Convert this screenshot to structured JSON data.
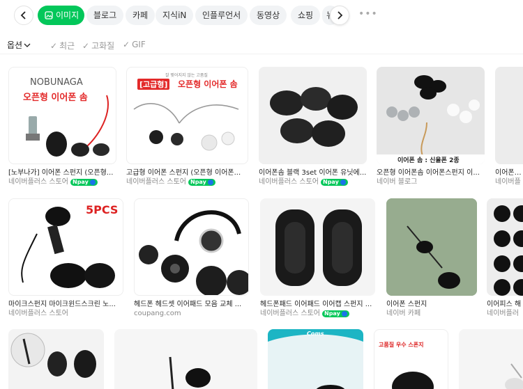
{
  "tabs": {
    "active": "이미지",
    "items": [
      "블로그",
      "카페",
      "지식iN",
      "인플루언서",
      "동영상",
      "쇼핑",
      "뉴"
    ]
  },
  "filters": {
    "options_label": "옵션",
    "recent": "최근",
    "hd": "고화질",
    "gif": "GIF"
  },
  "npay_label": "pay",
  "results": [
    {
      "caption": "[노부나가] 이어폰 스펀지 (오픈형...",
      "source": "네이버플러스 스토어",
      "npay": true,
      "thumb_text_top": "NOBUNAGA",
      "thumb_text_main": "오픈형 이어폰 솜"
    },
    {
      "caption": "고급형 이어폰 스펀지 (오픈형 이어폰...",
      "source": "네이버플러스 스토어",
      "npay": true,
      "thumb_text_small": "잘 찢어지지 않는 고품질",
      "thumb_text_badge": "[고급형]",
      "thumb_text_main": "오픈형 이어폰 솜"
    },
    {
      "caption": "이어폰솜 블랙 3set 이어폰 유닛에...",
      "source": "네이버플러스 스토어",
      "npay": true
    },
    {
      "caption": "오픈형 이어폰솜 이어폰스펀지 이...",
      "source": "네이버 블로그",
      "npay": false,
      "thumb_text_bottom": "이어폰 솜 : 신율폰 2종"
    },
    {
      "caption": "이어폰패드",
      "source": "네이버플",
      "npay": false
    },
    {
      "caption": "마이크스펀지 마이크윈드스크린 노...",
      "source": "네이버플러스 스토어",
      "npay": false,
      "thumb_text_main": "5PCS"
    },
    {
      "caption": "헤드폰 헤드셋 이어패드 모음 교체 ...",
      "source": "coupang.com",
      "npay": false
    },
    {
      "caption": "헤드폰패드 이어패드 이어캡 스펀지 ...",
      "source": "네이버플러스 스토어",
      "npay": true
    },
    {
      "caption": "이어폰 스펀지",
      "source": "네이버 카페",
      "npay": false
    },
    {
      "caption": "이어피스 해",
      "source": "네이버플러",
      "npay": false
    },
    {
      "caption": "",
      "source": "",
      "npay": false
    },
    {
      "caption": "",
      "source": "",
      "npay": false
    },
    {
      "caption": "",
      "source": "",
      "npay": false,
      "thumb_text_main": "Coms"
    },
    {
      "caption": "",
      "source": "",
      "npay": false,
      "thumb_text_main": "고품질 우수 스폰지"
    },
    {
      "caption": "",
      "source": "",
      "npay": false
    }
  ],
  "colors": {
    "accent": "#03c75a",
    "npay_plus": "#1a73e8",
    "brand_red": "#e32a2a"
  }
}
